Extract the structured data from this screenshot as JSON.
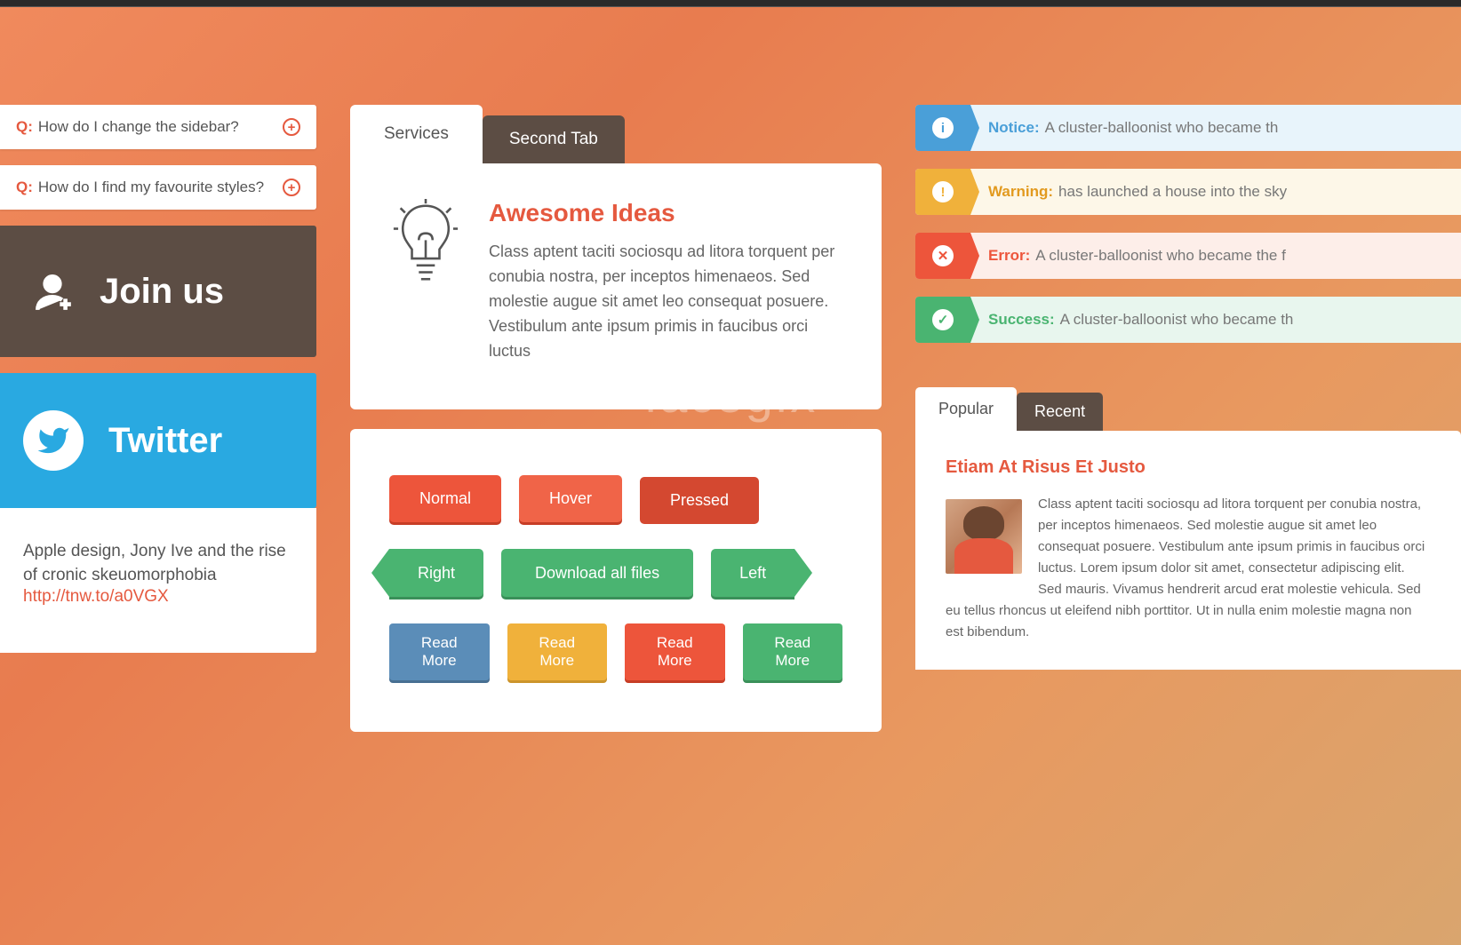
{
  "watermark": "facegfx",
  "faq": [
    {
      "q": "Q:",
      "text": "How do I change the sidebar?"
    },
    {
      "q": "Q:",
      "text": "How do I find my favourite styles?"
    }
  ],
  "joinus": {
    "label": "Join us"
  },
  "twitter": {
    "label": "Twitter",
    "body": "Apple design, Jony Ive and the rise of cronic skeuomorphobia",
    "link": "http://tnw.to/a0VGX"
  },
  "services": {
    "tabs": [
      {
        "label": "Services",
        "active": true
      },
      {
        "label": "Second Tab",
        "active": false
      }
    ],
    "title": "Awesome Ideas",
    "body": "Class aptent taciti sociosqu ad litora torquent per conubia nostra, per inceptos himenaeos. Sed molestie augue sit amet leo consequat posuere. Vestibulum ante ipsum primis in faucibus orci luctus"
  },
  "buttons": {
    "row1": [
      "Normal",
      "Hover",
      "Pressed"
    ],
    "row2": [
      "Right",
      "Download all files",
      "Left"
    ],
    "row3": [
      "Read More",
      "Read More",
      "Read More",
      "Read More"
    ]
  },
  "alerts": [
    {
      "type": "notice",
      "label": "Notice:",
      "text": "A cluster-balloonist who became th",
      "icon": "i"
    },
    {
      "type": "warning",
      "label": "Warning:",
      "text": "has launched a house into the sky",
      "icon": "!"
    },
    {
      "type": "error",
      "label": "Error:",
      "text": "A cluster-balloonist who became the f",
      "icon": "✕"
    },
    {
      "type": "success",
      "label": "Success:",
      "text": "A cluster-balloonist who became th",
      "icon": "✓"
    }
  ],
  "popular": {
    "tabs": [
      {
        "label": "Popular",
        "active": true
      },
      {
        "label": "Recent",
        "active": false
      }
    ],
    "title": "Etiam At Risus Et Justo",
    "body": "Class aptent taciti sociosqu ad litora torquent per conubia nostra, per inceptos himenaeos. Sed molestie augue sit amet leo consequat posuere. Vestibulum ante ipsum primis in faucibus orci luctus. Lorem ipsum dolor sit amet, consectetur adipiscing elit. Sed mauris. Vivamus hendrerit arcud erat molestie vehicula. Sed eu tellus rhoncus ut eleifend nibh porttitor. Ut in nulla enim molestie magna non est bibendum."
  }
}
